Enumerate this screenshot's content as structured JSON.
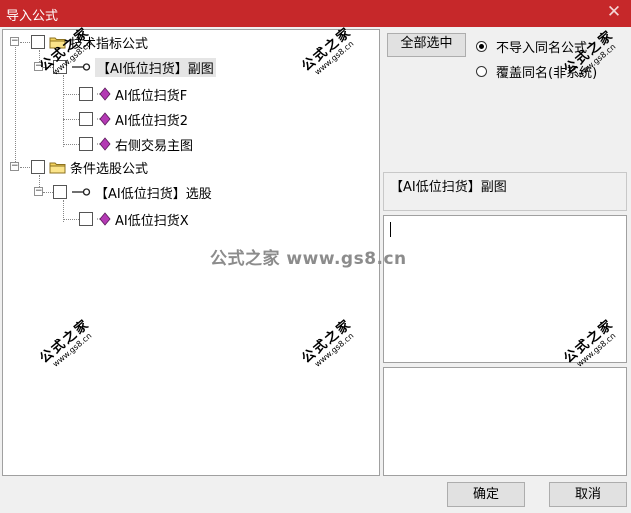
{
  "window": {
    "title": "导入公式",
    "close_glyph": "✕"
  },
  "tree": {
    "groups": [
      {
        "label": "技术指标公式",
        "children": [
          {
            "label": "【AI低位扫货】副图",
            "selected": true,
            "children": [
              {
                "label": "AI低位扫货F"
              },
              {
                "label": "AI低位扫货2"
              },
              {
                "label": "右侧交易主图"
              }
            ]
          }
        ]
      },
      {
        "label": "条件选股公式",
        "children": [
          {
            "label": "【AI低位扫货】选股",
            "selected": false,
            "children": [
              {
                "label": "AI低位扫货X"
              }
            ]
          }
        ]
      }
    ]
  },
  "controls": {
    "select_all_label": "全部选中",
    "radio_options": [
      {
        "label": "不导入同名公式",
        "checked": true
      },
      {
        "label": "覆盖同名(非系统)",
        "checked": false
      }
    ],
    "formula_name": "【AI低位扫货】副图",
    "ok_label": "确定",
    "cancel_label": "取消"
  },
  "watermark": {
    "brand": "公式之家",
    "url": "www.gs8.cn",
    "center_text": "公式之家 www.gs8.cn"
  },
  "icons": {
    "folder": "folder-icon",
    "formula": "diamond-formula-icon",
    "link": "link-icon",
    "close": "close-icon"
  },
  "colors": {
    "titlebar": "#c6282a",
    "folder": "#f4d35e",
    "diamond": "#b43ab4"
  }
}
